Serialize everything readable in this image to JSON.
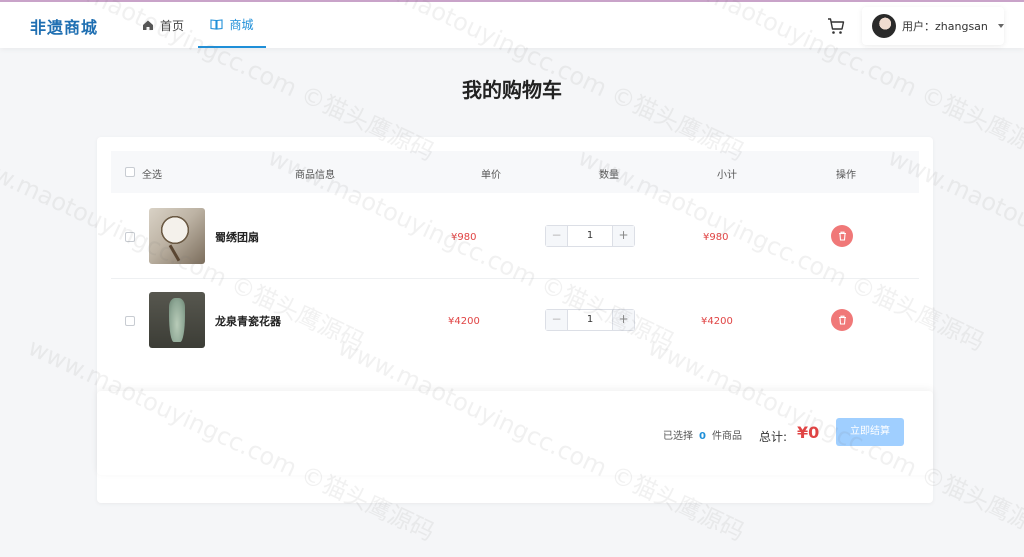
{
  "nav": {
    "brand": "非遗商城",
    "home_label": "首页",
    "mall_label": "商城",
    "user_label": "用户：zhangsan"
  },
  "page": {
    "title": "我的购物车"
  },
  "table": {
    "headers": {
      "select_all": "全选",
      "info": "商品信息",
      "price": "单价",
      "quantity": "数量",
      "subtotal": "小计",
      "actions": "操作"
    },
    "items": [
      {
        "name": "蜀绣团扇",
        "price": "¥980",
        "quantity": "1",
        "subtotal": "¥980"
      },
      {
        "name": "龙泉青瓷花器",
        "price": "¥4200",
        "quantity": "1",
        "subtotal": "¥4200"
      }
    ],
    "minus_symbol": "−",
    "plus_symbol": "+"
  },
  "footer": {
    "selected_prefix": "已选择",
    "selected_count": "0",
    "selected_suffix": "件商品",
    "total_label": "总计:",
    "total_value": "¥0",
    "checkout_label": "立即结算"
  },
  "watermark": {
    "text": "www.maotouyingcc.com ©猫头鹰源码"
  },
  "colors": {
    "brand": "#1f6fb2",
    "accent": "#1f8fd8",
    "price": "#e04444",
    "delete": "#f07878",
    "checkout_disabled": "#a0cfff"
  },
  "icons": {
    "home": "home-icon",
    "mall": "book-icon",
    "cart": "cart-icon",
    "delete": "trash-icon",
    "caret": "caret-down-icon"
  }
}
